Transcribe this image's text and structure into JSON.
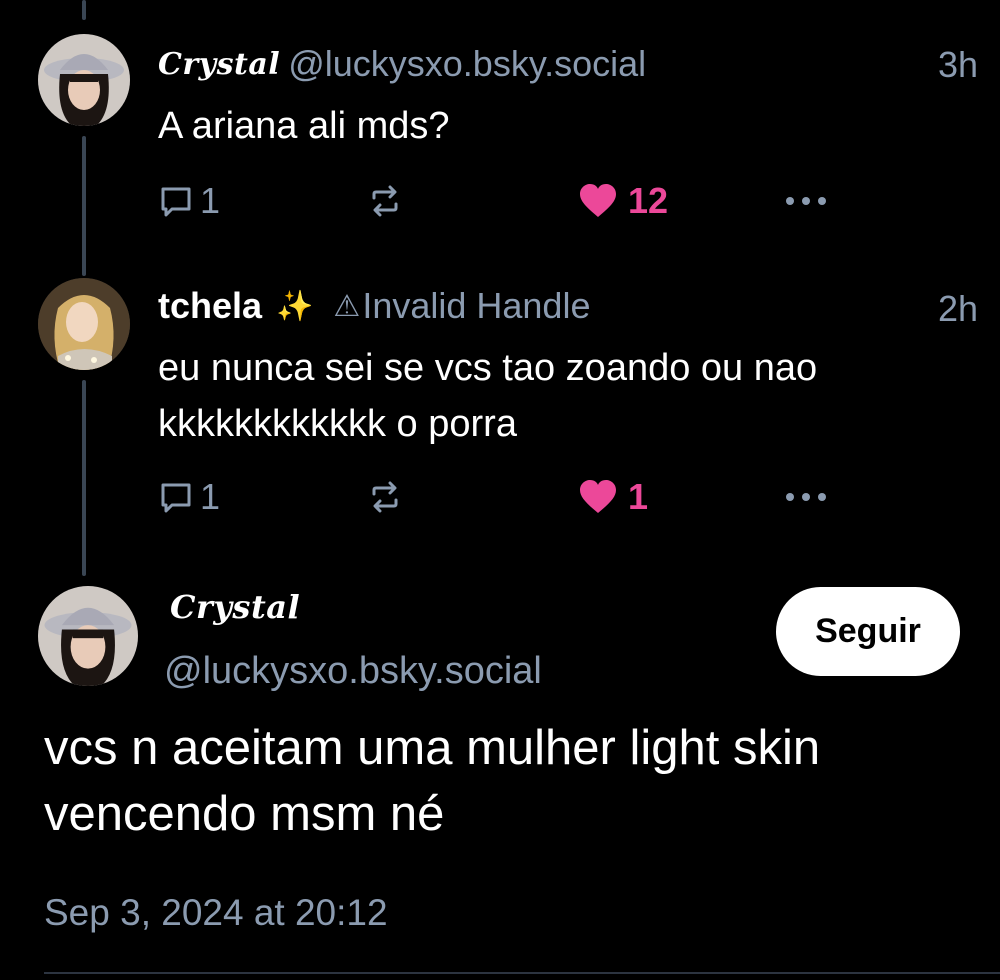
{
  "colors": {
    "background": "#000000",
    "muted": "#8b9bb0",
    "like": "#ec4899",
    "thread_line": "#3a4654"
  },
  "replies": [
    {
      "display_name": "Crystal",
      "handle": "@luckysxo.bsky.social",
      "time": "3h",
      "text_lines": [
        "A ariana ali mds?"
      ],
      "reply_count": "1",
      "like_count": "12",
      "liked": true
    },
    {
      "display_name": "tchela",
      "emoji": "✨",
      "warning_icon": "⚠",
      "handle": "Invalid Handle",
      "time": "2h",
      "text_lines": [
        "eu nunca sei se vcs tao zoando ou nao",
        "kkkkkkkkkkkk o porra"
      ],
      "reply_count": "1",
      "like_count": "1",
      "liked": true
    }
  ],
  "main_post": {
    "display_name": "Crystal",
    "handle": "@luckysxo.bsky.social",
    "follow_label": "Seguir",
    "text_lines": [
      "vcs n aceitam uma mulher light skin",
      "vencendo msm né"
    ],
    "date": "Sep 3, 2024 at 20:12"
  },
  "icons": {
    "reply": "speech-bubble-icon",
    "repost": "repost-arrows-icon",
    "like": "heart-icon",
    "more": "more-dots-icon",
    "verified_warning": "warning-triangle-icon"
  }
}
